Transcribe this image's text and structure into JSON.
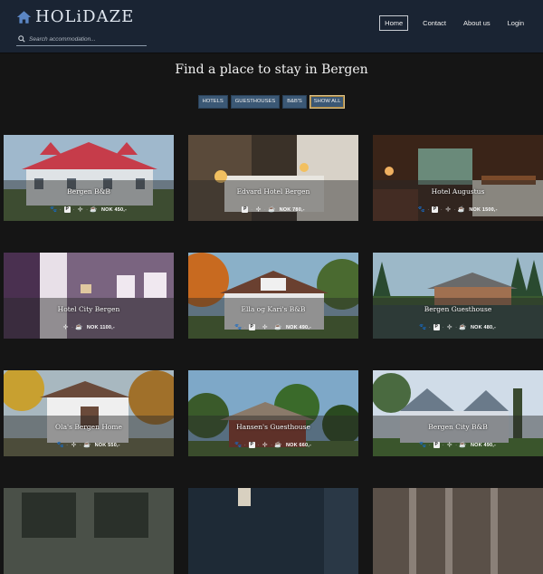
{
  "brand": {
    "name": "HOLiDAZE",
    "logo_icon": "house-icon"
  },
  "search": {
    "placeholder": "Search accommodation..."
  },
  "nav": [
    {
      "label": "Home",
      "active": true
    },
    {
      "label": "Contact",
      "active": false
    },
    {
      "label": "About us",
      "active": false
    },
    {
      "label": "Login",
      "active": false
    }
  ],
  "heading": "Find a place to stay in Bergen",
  "filters": [
    {
      "label": "HOTELS",
      "selected": false
    },
    {
      "label": "GUESTHOUSES",
      "selected": false
    },
    {
      "label": "B&B'S",
      "selected": false
    },
    {
      "label": "SHOW ALL",
      "selected": true
    }
  ],
  "cards": [
    {
      "name": "Bergen B&B",
      "price": "NOK 450,-",
      "icons": [
        "pet-icon",
        "parking-icon",
        "wifi-icon",
        "breakfast-icon"
      ],
      "image": "red-roof-house"
    },
    {
      "name": "Edvard Hotel Bergen",
      "price": "NOK 780,-",
      "icons": [
        "parking-icon",
        "wifi-icon",
        "breakfast-icon"
      ],
      "image": "hotel-bedroom"
    },
    {
      "name": "Hotel Augustus",
      "price": "NOK 1500,-",
      "icons": [
        "pet-icon",
        "parking-icon",
        "wifi-icon",
        "breakfast-icon"
      ],
      "image": "hotel-suite"
    },
    {
      "name": "Hotel City Bergen",
      "price": "NOK 1100,-",
      "icons": [
        "wifi-icon",
        "breakfast-icon"
      ],
      "image": "purple-room"
    },
    {
      "name": "Ella og Kari's B&B",
      "price": "NOK 490,-",
      "icons": [
        "pet-icon",
        "parking-icon",
        "wifi-icon",
        "breakfast-icon"
      ],
      "image": "autumn-house"
    },
    {
      "name": "Bergen Guesthouse",
      "price": "NOK 480,-",
      "icons": [
        "pet-icon",
        "parking-icon",
        "wifi-icon",
        "breakfast-icon"
      ],
      "image": "lake-cabin"
    },
    {
      "name": "Ola's Bergen Home",
      "price": "NOK 550,-",
      "icons": [
        "pet-icon",
        "wifi-icon",
        "breakfast-icon"
      ],
      "image": "white-cottage"
    },
    {
      "name": "Hansen's Guesthouse",
      "price": "NOK 660,-",
      "icons": [
        "pet-icon",
        "parking-icon",
        "wifi-icon",
        "breakfast-icon"
      ],
      "image": "brick-house"
    },
    {
      "name": "Bergen City B&B",
      "price": "NOK 490,-",
      "icons": [
        "pet-icon",
        "parking-icon",
        "wifi-icon",
        "breakfast-icon"
      ],
      "image": "blue-villa"
    },
    {
      "name": "",
      "price": "",
      "icons": [],
      "image": "dark-interior"
    },
    {
      "name": "",
      "price": "",
      "icons": [],
      "image": "lamp-room"
    },
    {
      "name": "",
      "price": "",
      "icons": [],
      "image": "forest"
    }
  ]
}
